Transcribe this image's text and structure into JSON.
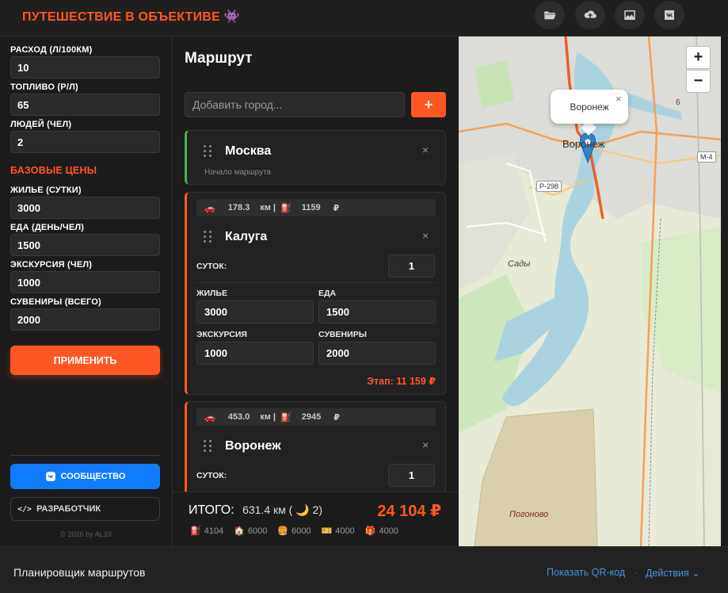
{
  "header": {
    "title": "ПУТЕШЕСТВИЕ В ОБЪЕКТИВЕ 👾",
    "buttons": [
      {
        "icon": "folder-open-icon"
      },
      {
        "icon": "cloud-upload-icon"
      },
      {
        "icon": "image-icon"
      },
      {
        "icon": "vk-icon"
      }
    ]
  },
  "sidebar": {
    "consumption_label": "РАСХОД (Л/100КМ)",
    "consumption_value": "10",
    "fuel_label": "ТОПЛИВО (Р/Л)",
    "fuel_value": "65",
    "people_label": "ЛЮДЕЙ (ЧЕЛ)",
    "people_value": "2",
    "base_prices_heading": "БАЗОВЫЕ ЦЕНЫ",
    "housing_label": "ЖИЛЬЕ (СУТКИ)",
    "housing_value": "3000",
    "food_label": "ЕДА (ДЕНЬ/ЧЕЛ)",
    "food_value": "1500",
    "excursion_label": "ЭКСКУРСИЯ (ЧЕЛ)",
    "excursion_value": "1000",
    "souvenirs_label": "СУВЕНИРЫ (ВСЕГО)",
    "souvenirs_value": "2000",
    "apply_label": "ПРИМЕНИТЬ",
    "community_label": "СООБЩЕСТВО",
    "developer_label": "РАЗРАБОТЧИК",
    "copyright": "© 2026 by AL3X"
  },
  "route": {
    "title": "Маршрут",
    "add_city_placeholder": "Добавить город...",
    "add_button_label": "+",
    "start_card": {
      "city": "Москва",
      "subtitle": "Начало маршрута"
    },
    "stages": [
      {
        "distance": "178.3",
        "km_unit": "км |",
        "fuel_cost": "1159",
        "currency": "₽",
        "city": "Калуга",
        "days_label": "СУТОК:",
        "days_value": "1",
        "housing_label": "ЖИЛЬЕ",
        "housing_value": "3000",
        "food_label": "ЕДА",
        "food_value": "1500",
        "excursion_label": "ЭКСКУРСИЯ",
        "excursion_value": "1000",
        "souvenirs_label": "СУВЕНИРЫ",
        "souvenirs_value": "2000",
        "stage_total": "Этап: 11 159 ₽"
      },
      {
        "distance": "453.0",
        "km_unit": "км |",
        "fuel_cost": "2945",
        "currency": "₽",
        "city": "Воронеж",
        "days_label": "СУТОК:",
        "days_value": "1"
      }
    ],
    "totals": {
      "label": "ИТОГО:",
      "distance": "631.4 км ( 🌙 2)",
      "sum": "24 104 ₽",
      "breakdown": [
        {
          "icon": "⛽",
          "value": "4104"
        },
        {
          "icon": "🏠",
          "value": "6000"
        },
        {
          "icon": "🍔",
          "value": "6000"
        },
        {
          "icon": "🎫",
          "value": "4000"
        },
        {
          "icon": "🎁",
          "value": "4000"
        }
      ]
    }
  },
  "map": {
    "zoom_in": "+",
    "zoom_out": "−",
    "popup_text": "Воронеж",
    "popup_close": "×",
    "city_label": "Воронеж",
    "labels": {
      "sady": "Сады",
      "pogonovo": "Погоново",
      "road_r298": "Р-298",
      "road_m4": "М-4",
      "road_6": "6"
    }
  },
  "bottombar": {
    "title": "Планировщик маршрутов",
    "qr_link": "Показать QR-код",
    "actions_link": "Действия ⌄"
  }
}
